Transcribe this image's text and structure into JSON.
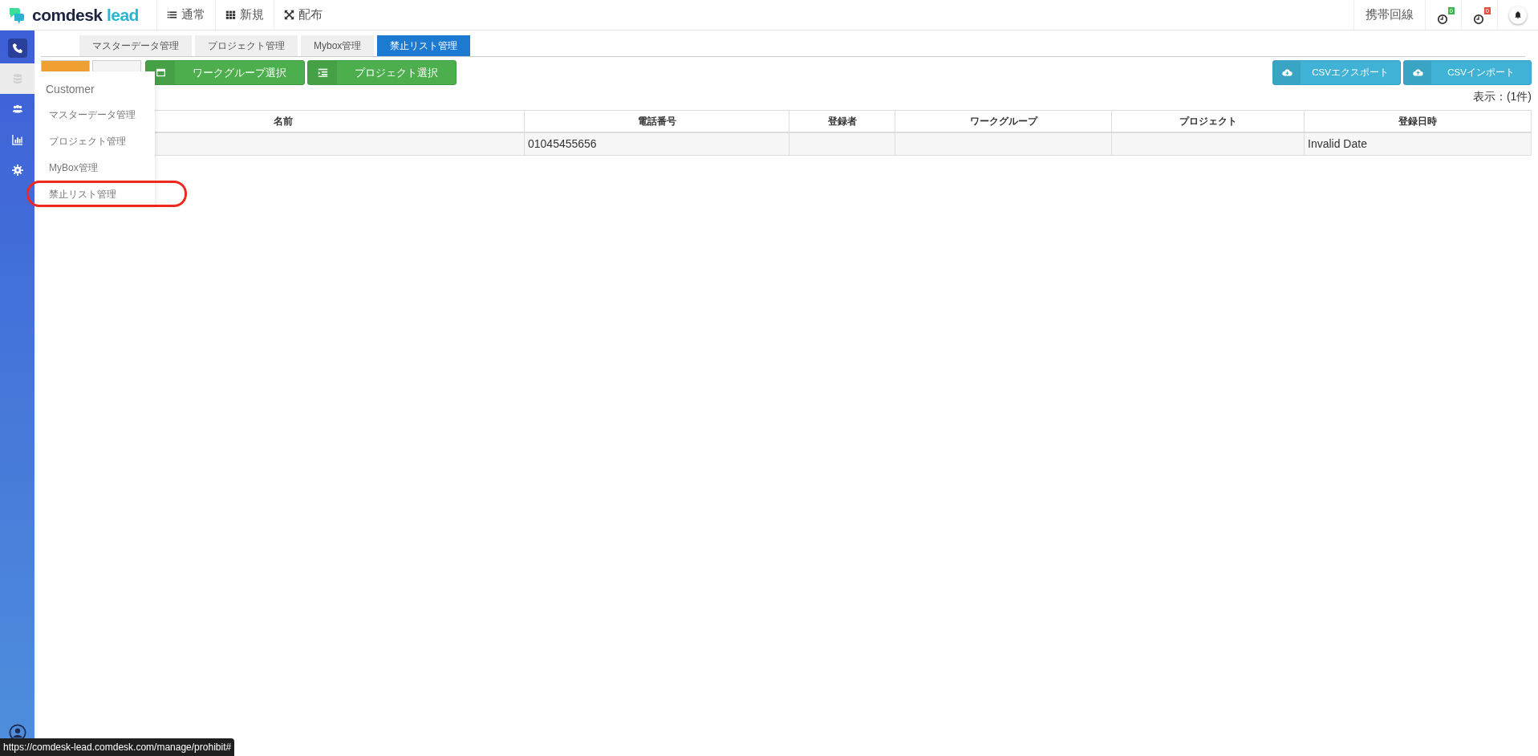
{
  "header": {
    "logo": {
      "primary": "comdesk",
      "secondary": "lead"
    },
    "nav": [
      {
        "label": "通常"
      },
      {
        "label": "新規"
      },
      {
        "label": "配布"
      }
    ],
    "line": "携帯回線",
    "timers": [
      {
        "count": "0",
        "color": "#3cb44b"
      },
      {
        "count": "0",
        "color": "#e74c3c"
      }
    ]
  },
  "sidebar": {
    "items": [
      {
        "selected": true,
        "expanded": false
      },
      {
        "selected": false,
        "expanded": true
      },
      {
        "selected": false,
        "expanded": false
      },
      {
        "selected": false,
        "expanded": false
      },
      {
        "selected": false,
        "expanded": false
      }
    ]
  },
  "tabs": [
    {
      "label": "マスターデータ管理",
      "selected": false
    },
    {
      "label": "プロジェクト管理",
      "selected": false
    },
    {
      "label": "Mybox管理",
      "selected": false
    },
    {
      "label": "禁止リスト管理",
      "selected": true
    }
  ],
  "filter_buttons": [
    {
      "color": "#f0a030"
    },
    {
      "color": "#f4f4f4"
    }
  ],
  "select_buttons": [
    "ワークグループ選択",
    "プロジェクト選択"
  ],
  "csv_buttons": [
    "CSVエクスポート",
    "CSVインポート"
  ],
  "count": "表示：(1件)",
  "table": {
    "columns": [
      "名前",
      "電話番号",
      "登録者",
      "ワークグループ",
      "プロジェクト",
      "登録日時"
    ],
    "rows": [
      {
        "cells": [
          null,
          "01045455656",
          null,
          null,
          null,
          "Invalid Date"
        ]
      }
    ]
  },
  "flyout": {
    "title": "Customer",
    "items": [
      {
        "label": "マスターデータ管理",
        "highlighted": false
      },
      {
        "label": "プロジェクト管理",
        "highlighted": false
      },
      {
        "label": "MyBox管理",
        "highlighted": false
      },
      {
        "label": "禁止リスト管理",
        "highlighted": true
      }
    ]
  },
  "status_url": "https://comdesk-lead.comdesk.com/manage/prohibit#"
}
